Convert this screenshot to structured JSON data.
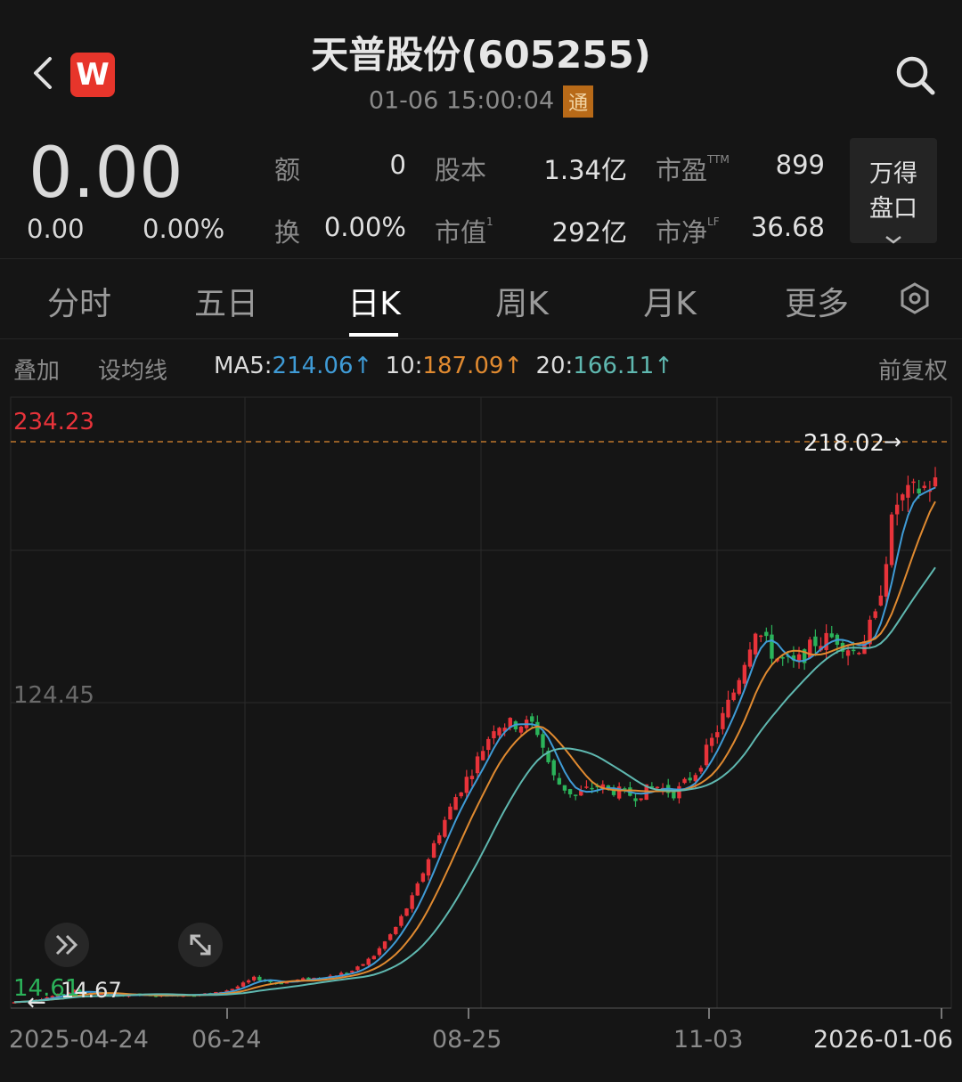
{
  "header": {
    "title": "天普股份(605255)",
    "datetime": "01-06 15:00:04",
    "badge": "通",
    "logo_letter": "W",
    "icons": [
      "back-arrow-icon",
      "wind-logo-icon",
      "search-icon"
    ]
  },
  "quote": {
    "price": "0.00",
    "change": "0.00",
    "change_pct": "0.00%",
    "stats": [
      {
        "label": "额",
        "value": "0"
      },
      {
        "label": "股本",
        "value": "1.34亿"
      },
      {
        "label": "市盈",
        "sup": "TTM",
        "value": "899"
      },
      {
        "label": "换",
        "value": "0.00%"
      },
      {
        "label": "市值",
        "sup": "1",
        "value": "292亿"
      },
      {
        "label": "市净",
        "sup": "LF",
        "value": "36.68"
      }
    ],
    "panel_button": {
      "line1": "万得",
      "line2": "盘口"
    }
  },
  "tabs": [
    {
      "label": "分时",
      "active": false
    },
    {
      "label": "五日",
      "active": false
    },
    {
      "label": "日K",
      "active": true
    },
    {
      "label": "周K",
      "active": false
    },
    {
      "label": "月K",
      "active": false
    },
    {
      "label": "更多",
      "active": false
    }
  ],
  "ma_bar": {
    "overlay": "叠加",
    "set_ma": "设均线",
    "ma5_label": "MA5:",
    "ma5_value": "214.06",
    "ma10_label": "10:",
    "ma10_value": "187.09",
    "ma20_label": "20:",
    "ma20_value": "166.11",
    "arrow": "↑",
    "adjust": "前复权"
  },
  "colors": {
    "up": "#e8333a",
    "down": "#2bb35a",
    "ma5": "#3f9bd6",
    "ma10": "#e08a30",
    "ma20": "#5fb8b0",
    "background": "#151515"
  },
  "chart_data": {
    "type": "candlestick",
    "y_labels": {
      "top": "234.23",
      "mid": "124.45",
      "low": "14.61"
    },
    "ylim": [
      14.61,
      234.23
    ],
    "last_close_label": "218.02",
    "low_marker": "14.67",
    "x_tick_labels": [
      "2025-04-24",
      "06-24",
      "08-25",
      "11-03",
      "2026-01-06"
    ],
    "series": [
      {
        "name": "MA5",
        "value": 214.06
      },
      {
        "name": "MA10",
        "value": 187.09
      },
      {
        "name": "MA20",
        "value": 166.11
      }
    ],
    "close_path": [
      15.5,
      16.5,
      18,
      20,
      19,
      18,
      18.5,
      18,
      18.2,
      18.5,
      19,
      21,
      25,
      23,
      24,
      25,
      26,
      28,
      34,
      44,
      58,
      78,
      95,
      108,
      124,
      124,
      124,
      102,
      96,
      100,
      98,
      96,
      100,
      97,
      105,
      120,
      138,
      162,
      150,
      147,
      156,
      158,
      152,
      165,
      210,
      215,
      218
    ]
  }
}
